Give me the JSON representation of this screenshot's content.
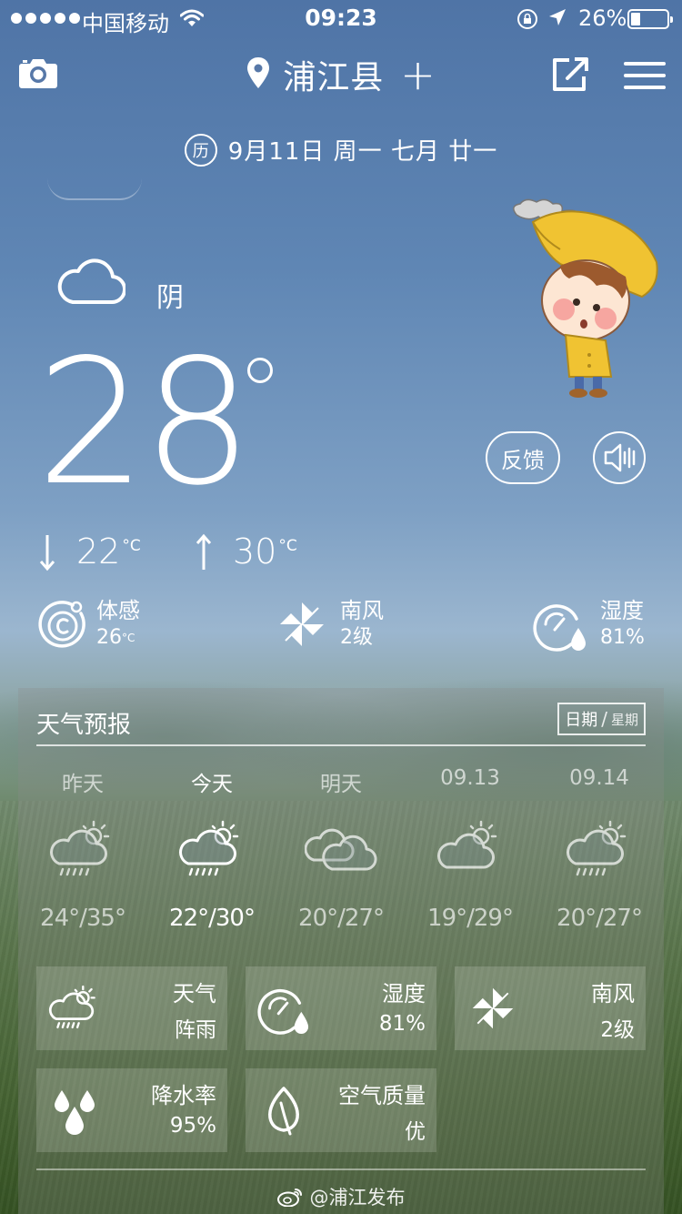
{
  "status_bar": {
    "carrier": "中国移动",
    "time": "09:23",
    "battery_percent": "26%",
    "battery_level": 0.26
  },
  "header": {
    "city": "浦江县",
    "add_symbol": "+"
  },
  "date": {
    "calendar_badge": "历",
    "text": "9月11日 周一  七月 廿一"
  },
  "current": {
    "condition": "阴",
    "condition_icon": "cloud-icon",
    "temperature": "28",
    "low": "22",
    "high": "30",
    "unit": "°C"
  },
  "buttons": {
    "feedback": "反馈",
    "voice_icon": "speaker-icon"
  },
  "metrics": {
    "feels_like_label": "体感",
    "feels_like_value": "26",
    "feels_like_unit": "°C",
    "wind_label": "南风",
    "wind_value": "2级",
    "humidity_label": "湿度",
    "humidity_value": "81%"
  },
  "forecast": {
    "title": "天气预报",
    "toggle_on": "日期",
    "toggle_slash": "/",
    "toggle_off": "星期",
    "days": [
      {
        "label": "昨天",
        "temp": "24°/35°",
        "icon": "sun-cloud-rain-icon"
      },
      {
        "label": "今天",
        "temp": "22°/30°",
        "icon": "sun-cloud-rain-icon"
      },
      {
        "label": "明天",
        "temp": "20°/27°",
        "icon": "double-cloud-icon"
      },
      {
        "label": "09.13",
        "temp": "19°/29°",
        "icon": "sun-cloud-icon"
      },
      {
        "label": "09.14",
        "temp": "20°/27°",
        "icon": "sun-cloud-rain-icon"
      }
    ]
  },
  "tiles": {
    "weather_name": "天气",
    "weather_value": "阵雨",
    "humidity_name": "湿度",
    "humidity_value": "81%",
    "wind_name": "南风",
    "wind_value": "2级",
    "precip_name": "降水率",
    "precip_value": "95%",
    "air_name": "空气质量",
    "air_value": "优"
  },
  "footer": {
    "weibo": "@浦江发布"
  }
}
